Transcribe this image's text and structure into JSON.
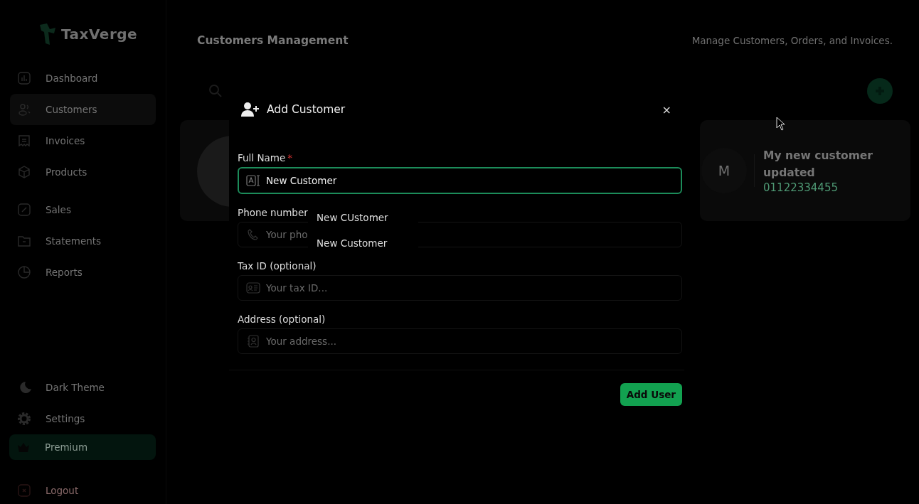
{
  "sidebar": {
    "logo": "TaxVerge",
    "items": [
      {
        "label": "Dashboard",
        "selected": false
      },
      {
        "label": "Customers",
        "selected": true
      },
      {
        "label": "Invoices",
        "selected": false
      },
      {
        "label": "Products",
        "selected": false
      },
      {
        "label": "Sales",
        "selected": false
      },
      {
        "label": "Statements",
        "selected": false
      },
      {
        "label": "Reports",
        "selected": false
      }
    ],
    "bottom_items": [
      {
        "label": "Dark Theme",
        "kind": "theme"
      },
      {
        "label": "Settings",
        "kind": "settings"
      },
      {
        "label": "Premium",
        "kind": "premium"
      },
      {
        "label": "Logout",
        "kind": "logout"
      }
    ]
  },
  "header": {
    "title": "Customers Management",
    "subtitle": "Manage Customers, Orders, and Invoices."
  },
  "customers": [
    {
      "kind": "photo"
    },
    {
      "kind": "initial",
      "initial": "M",
      "name": "My new customer updated",
      "phone": "01122334455"
    }
  ],
  "dialog": {
    "title": "Add Customer",
    "close": "×",
    "fields": [
      {
        "label": "Full Name",
        "required": true,
        "focused": true,
        "value": "New Customer"
      },
      {
        "label": "Phone number",
        "required": false,
        "focused": false,
        "placeholder": "Your pho"
      },
      {
        "label": "Tax ID (optional)",
        "required": false,
        "focused": false,
        "placeholder": "Your tax ID..."
      },
      {
        "label": "Address (optional)",
        "required": false,
        "focused": false,
        "placeholder": "Your address..."
      }
    ],
    "required_mark": "*",
    "suggestions": [
      "New CUstomer",
      "New Customer"
    ],
    "submit": "Add User"
  }
}
